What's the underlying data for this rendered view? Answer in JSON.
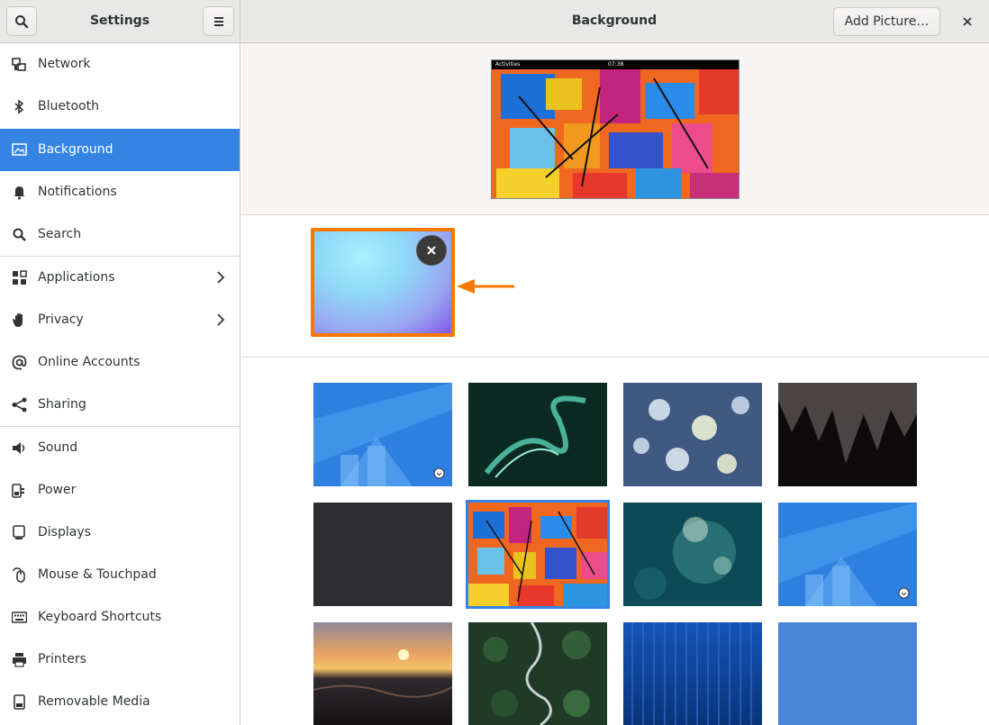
{
  "sidebar_header": {
    "title": "Settings"
  },
  "header": {
    "title": "Background",
    "add_picture_label": "Add Picture…"
  },
  "sidebar": {
    "items": [
      {
        "label": "Network",
        "icon": "network-icon"
      },
      {
        "label": "Bluetooth",
        "icon": "bluetooth-icon"
      },
      {
        "label": "Background",
        "icon": "background-icon",
        "active": true
      },
      {
        "label": "Notifications",
        "icon": "bell-icon"
      },
      {
        "label": "Search",
        "icon": "search-icon"
      },
      {
        "label": "Applications",
        "icon": "apps-grid-icon",
        "has_submenu": true
      },
      {
        "label": "Privacy",
        "icon": "hand-icon",
        "has_submenu": true
      },
      {
        "label": "Online Accounts",
        "icon": "at-sign-icon"
      },
      {
        "label": "Sharing",
        "icon": "share-icon"
      },
      {
        "label": "Sound",
        "icon": "speaker-icon"
      },
      {
        "label": "Power",
        "icon": "power-plug-icon"
      },
      {
        "label": "Displays",
        "icon": "display-icon"
      },
      {
        "label": "Mouse & Touchpad",
        "icon": "mouse-icon"
      },
      {
        "label": "Keyboard Shortcuts",
        "icon": "keyboard-icon"
      },
      {
        "label": "Printers",
        "icon": "printer-icon"
      },
      {
        "label": "Removable Media",
        "icon": "usb-drive-icon"
      }
    ]
  },
  "preview": {
    "activities": "Activities",
    "clock": "07:38"
  },
  "colors": {
    "accent": "#3584e4",
    "highlight": "#f57900"
  }
}
